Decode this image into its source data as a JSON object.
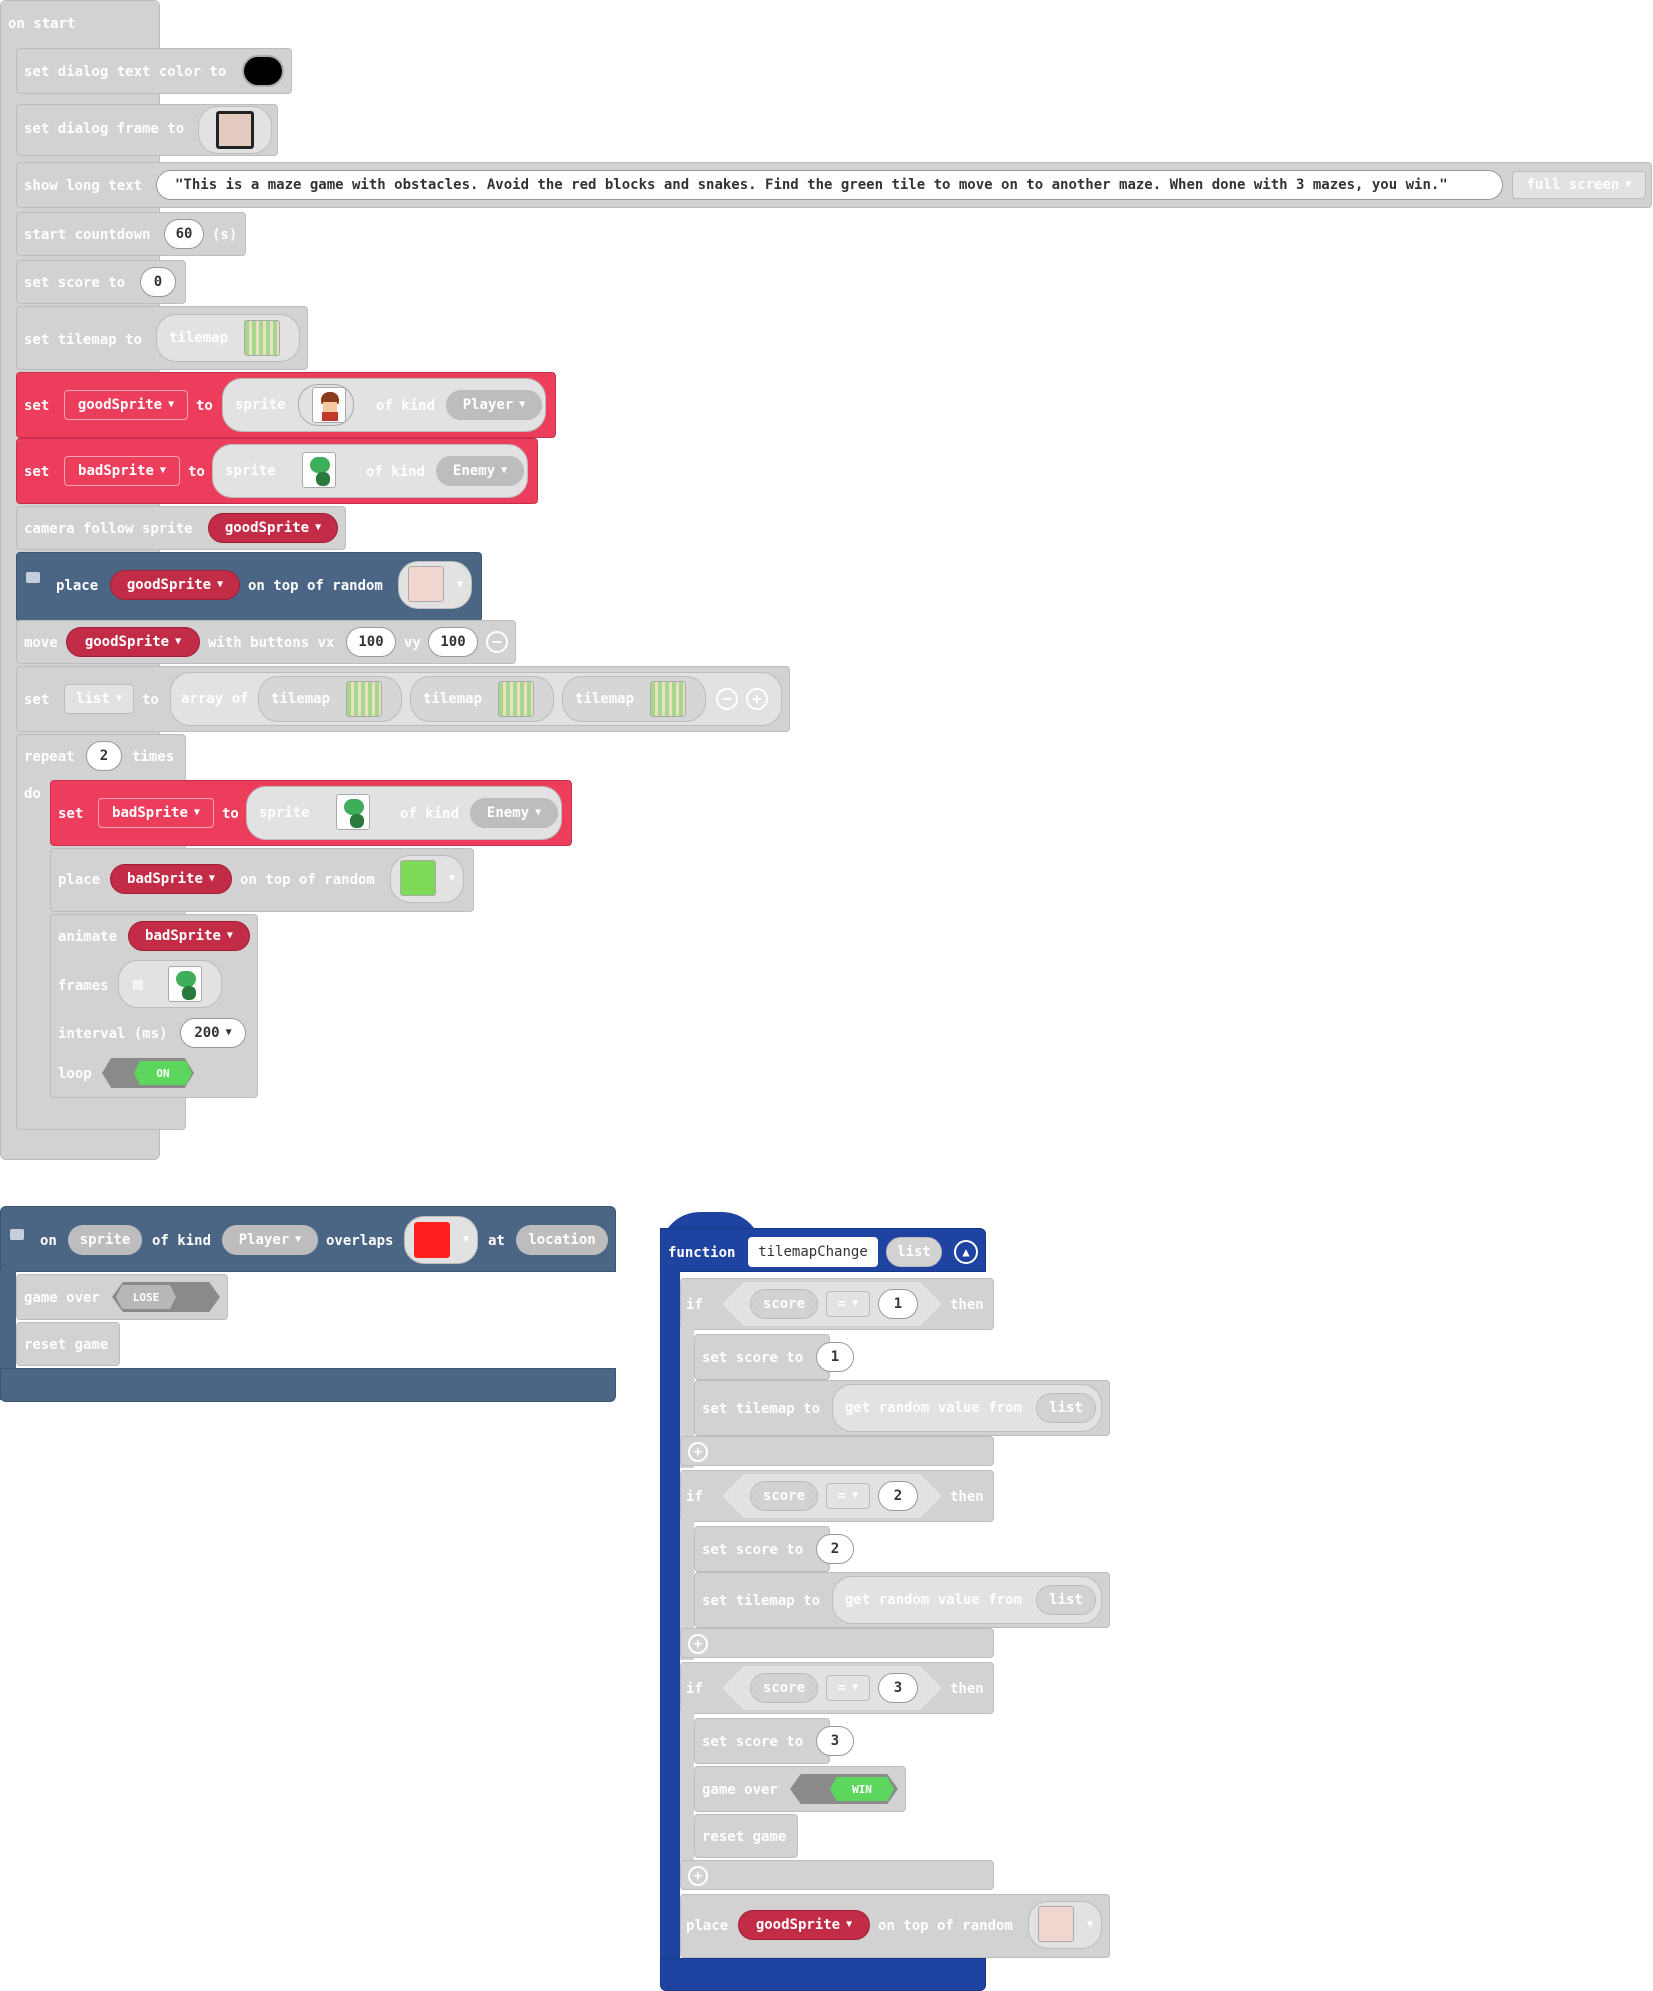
{
  "on_start": {
    "hat": "on start",
    "dialog_color": {
      "label": "set dialog text color to",
      "color": "#000000"
    },
    "dialog_frame": {
      "label": "set dialog frame to"
    },
    "long_text": {
      "label": "show long text",
      "text": "This is a maze game with obstacles. Avoid the red blocks and snakes. Find the green tile to move on to another maze. When done with 3 mazes, you win.",
      "mode": "full screen"
    },
    "countdown": {
      "label": "start countdown",
      "value": "60",
      "unit": "(s)"
    },
    "score": {
      "label": "set score to",
      "value": "0"
    },
    "tilemap": {
      "label": "set tilemap to",
      "value": "tilemap"
    },
    "good": {
      "set": "set",
      "var": "goodSprite",
      "to": "to",
      "sprite": "sprite",
      "kind_label": "of kind",
      "kind": "Player"
    },
    "bad": {
      "set": "set",
      "var": "badSprite",
      "to": "to",
      "sprite": "sprite",
      "kind_label": "of kind",
      "kind": "Enemy"
    },
    "camera": {
      "label": "camera follow sprite",
      "var": "goodSprite"
    },
    "place": {
      "label": "place",
      "var": "goodSprite",
      "mid": "on top of random"
    },
    "move": {
      "label": "move",
      "var": "goodSprite",
      "with": "with buttons vx",
      "vx": "100",
      "vy_label": "vy",
      "vy": "100"
    },
    "set_list": {
      "set": "set",
      "var": "list",
      "to": "to",
      "array": "array of",
      "items": [
        "tilemap",
        "tilemap",
        "tilemap"
      ]
    },
    "repeat": {
      "label": "repeat",
      "count": "2",
      "times": "times",
      "do": "do"
    },
    "inner_bad": {
      "set": "set",
      "var": "badSprite",
      "to": "to",
      "sprite": "sprite",
      "kind_label": "of kind",
      "kind": "Enemy"
    },
    "inner_place": {
      "label": "place",
      "var": "badSprite",
      "mid": "on top of random"
    },
    "animate": {
      "label": "animate",
      "var": "badSprite",
      "frames": "frames",
      "interval": "interval (ms)",
      "interval_value": "200",
      "loop": "loop",
      "loop_value": "ON"
    }
  },
  "overlap": {
    "on": "on",
    "sprite": "sprite",
    "kind_label": "of kind",
    "kind": "Player",
    "overlaps": "overlaps",
    "at": "at",
    "location": "location",
    "tile_color": "#ff1f1f",
    "game_over": {
      "label": "game over",
      "value": "LOSE"
    },
    "reset": "reset game"
  },
  "function": {
    "label": "function",
    "name": "tilemapChange",
    "param": "list",
    "ifs": [
      {
        "if": "if",
        "var": "score",
        "op": "=",
        "value": "1",
        "then": "then",
        "set_score": "set score to",
        "score_value": "1",
        "set_tilemap": "set tilemap to",
        "get": "get random value from",
        "list": "list"
      },
      {
        "if": "if",
        "var": "score",
        "op": "=",
        "value": "2",
        "then": "then",
        "set_score": "set score to",
        "score_value": "2",
        "set_tilemap": "set tilemap to",
        "get": "get random value from",
        "list": "list"
      },
      {
        "if": "if",
        "var": "score",
        "op": "=",
        "value": "3",
        "then": "then",
        "set_score": "set score to",
        "score_value": "3",
        "game_over": "game over",
        "game_over_value": "WIN",
        "reset": "reset game"
      }
    ],
    "place": {
      "label": "place",
      "var": "goodSprite",
      "mid": "on top of random"
    }
  },
  "colors": {
    "gray": "#d2d2d2",
    "sprite_red": "#ec3d5d",
    "scene": "#4b6584",
    "function": "#1e43a0",
    "win_green": "#5cd65c"
  }
}
